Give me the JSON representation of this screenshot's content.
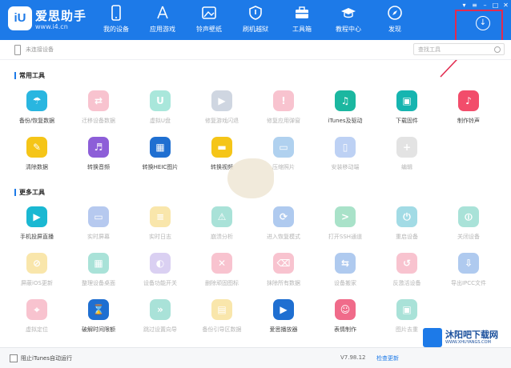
{
  "app": {
    "logo_text": "iU",
    "name": "爱思助手",
    "url": "www.i4.cn"
  },
  "colors": {
    "header": "#1d7ae8",
    "accent": "#1d7ae8",
    "highlight": "#e22b4f"
  },
  "nav": [
    {
      "label": "我的设备",
      "icon": "phone-icon"
    },
    {
      "label": "应用游戏",
      "icon": "app-store-icon"
    },
    {
      "label": "铃声壁纸",
      "icon": "wallpaper-icon"
    },
    {
      "label": "刷机越狱",
      "icon": "shield-icon"
    },
    {
      "label": "工具箱",
      "icon": "toolbox-icon"
    },
    {
      "label": "教程中心",
      "icon": "graduation-cap-icon"
    },
    {
      "label": "发现",
      "icon": "compass-icon"
    }
  ],
  "subbar": {
    "device_label": "未连接设备",
    "search_placeholder": "查找工具"
  },
  "sections": [
    {
      "title": "常用工具",
      "tools": [
        {
          "label": "备份/恢复数据",
          "color": "#29b6e0",
          "glyph": "☂",
          "faded": false
        },
        {
          "label": "迁移设备数据",
          "color": "#f06b8a",
          "glyph": "⇄",
          "faded": true
        },
        {
          "label": "虚拟U盘",
          "color": "#2bc4a8",
          "glyph": "U",
          "faded": true
        },
        {
          "label": "修复游戏闪退",
          "color": "#8a9bb5",
          "glyph": "▶",
          "faded": true
        },
        {
          "label": "修复应用弹窗",
          "color": "#f06b8a",
          "glyph": "!",
          "faded": true
        },
        {
          "label": "iTunes及驱动",
          "color": "#1bb7a0",
          "glyph": "♫",
          "faded": false
        },
        {
          "label": "下载固件",
          "color": "#16b5b0",
          "glyph": "▣",
          "faded": false
        },
        {
          "label": "制作铃声",
          "color": "#f24d6b",
          "glyph": "♪",
          "faded": false
        },
        {
          "label": "清除数据",
          "color": "#f5c518",
          "glyph": "✎",
          "faded": false
        },
        {
          "label": "转换音频",
          "color": "#8d5ed8",
          "glyph": "♬",
          "faded": false
        },
        {
          "label": "转换HEIC图片",
          "color": "#1f6fd1",
          "glyph": "▦",
          "faded": false
        },
        {
          "label": "转换视频",
          "color": "#f5c518",
          "glyph": "▬",
          "faded": false
        },
        {
          "label": "压缩照片",
          "color": "#3c8fd8",
          "glyph": "▭",
          "faded": true
        },
        {
          "label": "安装移动端",
          "color": "#5b8ee6",
          "glyph": "▯",
          "faded": true
        },
        {
          "label": "编辑",
          "color": "#bbbbbb",
          "glyph": "+",
          "faded": true
        }
      ]
    },
    {
      "title": "更多工具",
      "tools": [
        {
          "label": "手机投屏直播",
          "color": "#1ab8d2",
          "glyph": "▶",
          "faded": false
        },
        {
          "label": "实时屏幕",
          "color": "#4a7bd8",
          "glyph": "▭",
          "faded": true
        },
        {
          "label": "实时日志",
          "color": "#f2c230",
          "glyph": "≡",
          "faded": true
        },
        {
          "label": "崩溃分析",
          "color": "#2bb8a0",
          "glyph": "⚠",
          "faded": true
        },
        {
          "label": "进入恢复模式",
          "color": "#3a7cd8",
          "glyph": "⟳",
          "faded": true
        },
        {
          "label": "打开SSH通道",
          "color": "#2bb87a",
          "glyph": ">",
          "faded": true
        },
        {
          "label": "重启设备",
          "color": "#1aa6c0",
          "glyph": "⏻",
          "faded": true
        },
        {
          "label": "关闭设备",
          "color": "#2bb8a0",
          "glyph": "⏼",
          "faded": true
        },
        {
          "label": "屏蔽iOS更新",
          "color": "#f2c230",
          "glyph": "⊘",
          "faded": true
        },
        {
          "label": "整理设备桌面",
          "color": "#2bb8a0",
          "glyph": "▦",
          "faded": true
        },
        {
          "label": "设备功能开关",
          "color": "#a58be0",
          "glyph": "◐",
          "faded": true
        },
        {
          "label": "删除顽固图标",
          "color": "#f06b8a",
          "glyph": "✕",
          "faded": true
        },
        {
          "label": "抹除所有数据",
          "color": "#f06b8a",
          "glyph": "⌫",
          "faded": true
        },
        {
          "label": "设备搬家",
          "color": "#3a7cd8",
          "glyph": "⇆",
          "faded": true
        },
        {
          "label": "反激活设备",
          "color": "#f06b8a",
          "glyph": "↺",
          "faded": true
        },
        {
          "label": "导出IPCC文件",
          "color": "#3a7cd8",
          "glyph": "⇩",
          "faded": true
        },
        {
          "label": "虚拟定位",
          "color": "#f06b8a",
          "glyph": "⌖",
          "faded": true
        },
        {
          "label": "破解时间限额",
          "color": "#1f6fd1",
          "glyph": "⌛",
          "faded": false
        },
        {
          "label": "跳过设置向导",
          "color": "#2bb8a0",
          "glyph": "»",
          "faded": true
        },
        {
          "label": "备份引导区数据",
          "color": "#f2c230",
          "glyph": "▤",
          "faded": true
        },
        {
          "label": "爱思播放器",
          "color": "#1f6fd1",
          "glyph": "▶",
          "faded": false
        },
        {
          "label": "表情制作",
          "color": "#f06b8a",
          "glyph": "☺",
          "faded": false
        },
        {
          "label": "图片去重",
          "color": "#2bb8a0",
          "glyph": "▣",
          "faded": true
        }
      ]
    }
  ],
  "footer": {
    "checkbox_label": "阻止iTunes自动运行",
    "version": "V7.98.12",
    "update_label": "检查更新"
  },
  "watermark": {
    "site_name": "沐阳吧下载网",
    "site_url": "WWW.XHUYANGS.COM"
  }
}
